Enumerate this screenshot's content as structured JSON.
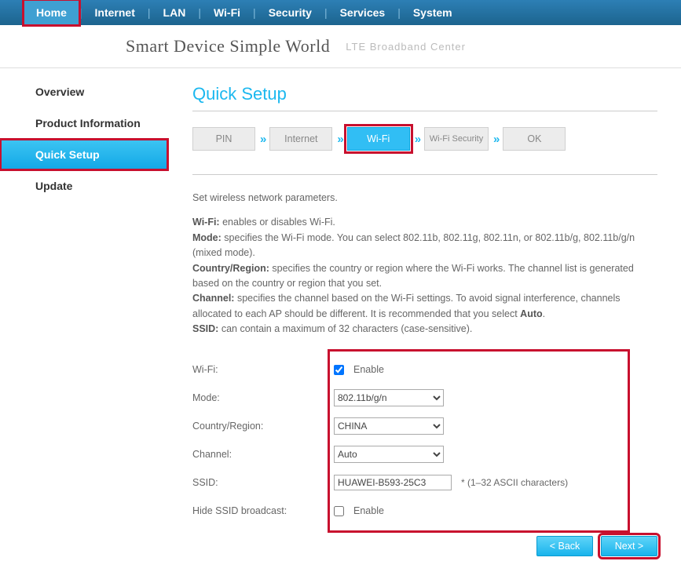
{
  "topnav": {
    "items": [
      "Home",
      "Internet",
      "LAN",
      "Wi-Fi",
      "Security",
      "Services",
      "System"
    ],
    "active": "Home"
  },
  "branding": {
    "line1": "Smart Device   Simple World",
    "line2": "LTE  Broadband  Center"
  },
  "sidebar": {
    "items": [
      "Overview",
      "Product Information",
      "Quick Setup",
      "Update"
    ],
    "active": "Quick Setup"
  },
  "page": {
    "title": "Quick Setup"
  },
  "wizard": {
    "steps": [
      "PIN",
      "Internet",
      "Wi-Fi",
      "Wi-Fi Security",
      "OK"
    ],
    "active": "Wi-Fi",
    "arrow": "»"
  },
  "desc": {
    "intro": "Set wireless network parameters.",
    "wifi_l": "Wi-Fi:",
    "wifi_t": " enables or disables Wi-Fi.",
    "mode_l": "Mode:",
    "mode_t": " specifies the Wi-Fi mode. You can select 802.11b, 802.11g, 802.11n, or 802.11b/g, 802.11b/g/n (mixed mode).",
    "cr_l": "Country/Region:",
    "cr_t": " specifies the country or region where the Wi-Fi works. The channel list is generated based on the country or region that you set.",
    "ch_l": "Channel:",
    "ch_t1": " specifies the channel based on the Wi-Fi settings. To avoid signal interference, channels allocated to each AP should be different. It is recommended that you select ",
    "ch_t2": "Auto",
    "ch_t3": ".",
    "ssid_l": "SSID:",
    "ssid_t": " can contain a maximum of 32 characters (case-sensitive)."
  },
  "form": {
    "wifi": {
      "label": "Wi-Fi:",
      "opt": "Enable",
      "checked": true
    },
    "mode": {
      "label": "Mode:",
      "value": "802.11b/g/n"
    },
    "country": {
      "label": "Country/Region:",
      "value": "CHINA"
    },
    "channel": {
      "label": "Channel:",
      "value": "Auto"
    },
    "ssid": {
      "label": "SSID:",
      "value": "HUAWEI-B593-25C3",
      "hint": "*   (1–32 ASCII characters)"
    },
    "hide": {
      "label": "Hide SSID broadcast:",
      "opt": "Enable",
      "checked": false
    }
  },
  "footer": {
    "back": "< Back",
    "next": "Next >"
  }
}
